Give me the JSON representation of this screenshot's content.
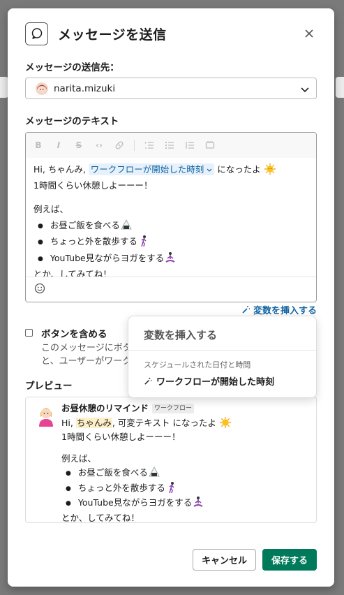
{
  "header": {
    "title": "メッセージを送信"
  },
  "recipient": {
    "label": "メッセージの送信先：",
    "value": "narita.mizuki"
  },
  "message": {
    "label": "メッセージのテキスト",
    "line1_prefix": "Hi, ちゃんみ, ",
    "variable_pill": "ワークフローが開始した時刻",
    "line1_suffix": " になったよ",
    "line2": "1時間くらい休憩しよーーー！",
    "line3": "例えば、",
    "bullets": [
      "お昼ご飯を食べる",
      "ちょっと外を散歩する",
      "YouTube見ながらヨガをする"
    ],
    "closing": "とか、してみてね！"
  },
  "insert_variable_link": "変数を挿入する",
  "button_option": {
    "title": "ボタンを含める",
    "desc_line1": "このメッセージにボタ",
    "desc_line2": "と、ユーザーがワーク"
  },
  "popover": {
    "title": "変数を挿入する",
    "section": "スケジュールされた日付と時間",
    "item": "ワークフローが開始した時刻"
  },
  "preview": {
    "label": "プレビュー",
    "sender": "お昼休憩のリマインド",
    "badge": "ワークフロー",
    "line1_prefix": "Hi, ",
    "highlight": "ちゃんみ",
    "line1_suffix": ", 可変テキスト になったよ",
    "line2": "1時間くらい休憩しよーーー！",
    "line3": "例えば、",
    "bullets": [
      "お昼ご飯を食べる",
      "ちょっと外を散歩する",
      "YouTube見ながらヨガをする"
    ],
    "closing": "とか、してみてね！"
  },
  "footer": {
    "cancel": "キャンセル",
    "save": "保存する"
  },
  "colors": {
    "primary": "#007a5a",
    "link": "#1264a3",
    "pill_bg": "#e6f1fb",
    "highlight_bg": "#fdf0c8"
  }
}
